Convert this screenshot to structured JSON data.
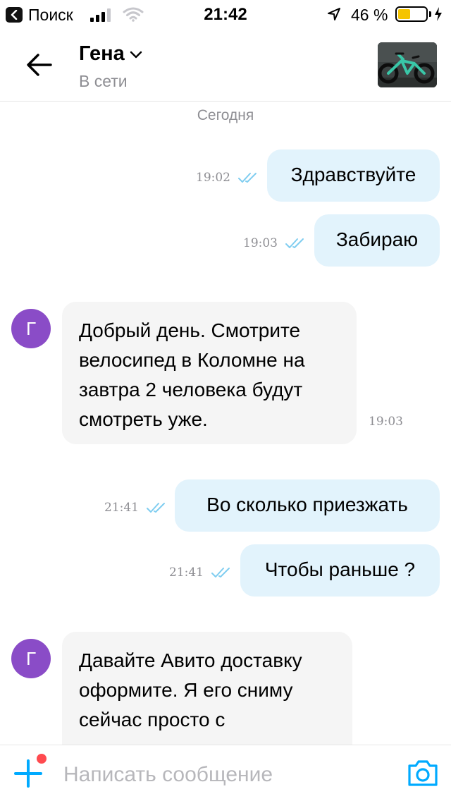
{
  "status_bar": {
    "back_app": "Поиск",
    "time": "21:42",
    "battery_percent": "46 %",
    "battery_level": 0.46
  },
  "header": {
    "contact_name": "Гена",
    "contact_status": "В сети"
  },
  "chat": {
    "date_separator": "Сегодня",
    "messages": [
      {
        "direction": "outgoing",
        "text": "Здравствуйте",
        "time": "19:02",
        "read": true
      },
      {
        "direction": "outgoing",
        "text": "Забираю",
        "time": "19:03",
        "read": true
      },
      {
        "direction": "incoming",
        "avatar_letter": "Г",
        "lines": [
          "Добрый день. Смотрите",
          "велосипед в Коломне на",
          "завтра 2 человека будут",
          "смотреть уже."
        ],
        "time": "19:03"
      },
      {
        "direction": "outgoing",
        "text": "Во сколько приезжать",
        "time": "21:41",
        "read": true
      },
      {
        "direction": "outgoing",
        "text": "Чтобы раньше ?",
        "time": "21:41",
        "read": true
      },
      {
        "direction": "incoming",
        "avatar_letter": "Г",
        "lines": [
          "Давайте Авито доставку",
          "оформите. Я его сниму",
          "сейчас просто с"
        ],
        "time": ""
      }
    ]
  },
  "composer": {
    "placeholder": "Написать сообщение",
    "value": ""
  },
  "colors": {
    "outgoing_bubble": "#e2f3fc",
    "incoming_bubble": "#f5f5f5",
    "avatar": "#8a4cc7",
    "accent": "#00aaff",
    "read_ticks": "#7fcdf0",
    "notification_dot": "#ff4a4f",
    "battery_fill": "#f5c400"
  },
  "icons": {
    "back": "arrow-left-icon",
    "chevron": "chevron-down-icon",
    "add": "plus-icon",
    "camera": "camera-icon",
    "read": "double-check-icon"
  }
}
